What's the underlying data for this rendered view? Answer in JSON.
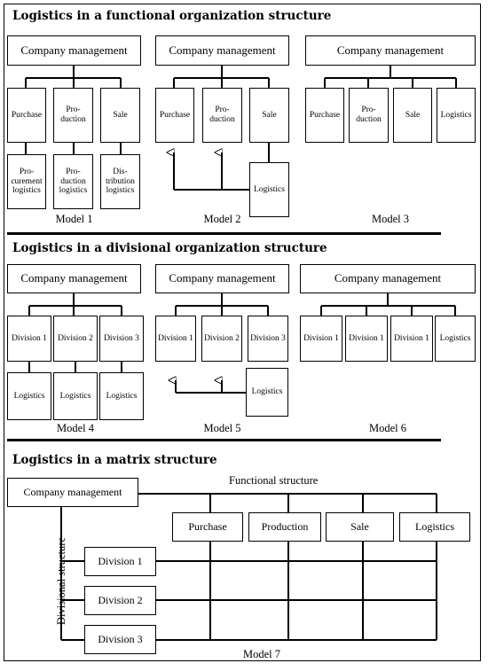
{
  "page": {
    "background": "#ffffff",
    "line_color": "#000000"
  },
  "sections": [
    {
      "id": "functional",
      "title": "Logistics in a functional organization structure",
      "models": [
        {
          "caption": "Model 1",
          "management": "Company management",
          "units": [
            "Purchase",
            "Pro-\nduction",
            "Sale"
          ],
          "leaves": [
            "Pro-\ncurement\nlogistics",
            "Pro-\nduction\nlogistics",
            "Dis-\ntribution\nlogistics"
          ]
        },
        {
          "caption": "Model 2",
          "management": "Company management",
          "units": [
            "Purchase",
            "Pro-\nduction",
            "Sale"
          ],
          "staff": "Logistics"
        },
        {
          "caption": "Model 3",
          "management": "Company management",
          "units": [
            "Purchase",
            "Pro-\nduction",
            "Sale",
            "Logistics"
          ]
        }
      ]
    },
    {
      "id": "divisional",
      "title": "Logistics in a divisional organization structure",
      "models": [
        {
          "caption": "Model 4",
          "management": "Company management",
          "units": [
            "Division 1",
            "Division 2",
            "Division 3"
          ],
          "leaves": [
            "Logistics",
            "Logistics",
            "Logistics"
          ]
        },
        {
          "caption": "Model 5",
          "management": "Company management",
          "units": [
            "Division 1",
            "Division 2",
            "Division 3"
          ],
          "staff": "Logistics"
        },
        {
          "caption": "Model 6",
          "management": "Company management",
          "units": [
            "Division 1",
            "Division 1",
            "Division 1",
            "Logistics"
          ]
        }
      ]
    },
    {
      "id": "matrix",
      "title": "Logistics in a matrix structure",
      "model": {
        "caption": "Model 7",
        "management": "Company management",
        "functional_axis_label": "Functional structure",
        "divisional_axis_label": "Divisional structure",
        "columns": [
          "Purchase",
          "Production",
          "Sale",
          "Logistics"
        ],
        "rows": [
          "Division 1",
          "Division 2",
          "Division 3"
        ]
      }
    }
  ]
}
